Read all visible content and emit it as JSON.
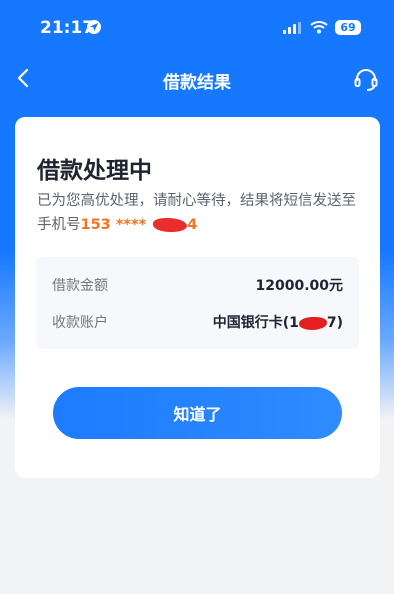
{
  "status_bar": {
    "time": "21:17",
    "battery": "69"
  },
  "nav": {
    "title": "借款结果",
    "back_icon": "chevron-left-icon",
    "support_icon": "headset-icon"
  },
  "result": {
    "title": "借款处理中",
    "description": "已为您高优处理，请耐心等待，结果将短信发送至手机号",
    "phone_visible": "153 **** ",
    "phone_tail_hint": "4"
  },
  "details": [
    {
      "label": "借款金额",
      "value": "12000.00元"
    },
    {
      "label": "收款账户",
      "value_prefix": "中国银行卡(1",
      "value_suffix": "7)"
    }
  ],
  "actions": {
    "confirm_label": "知道了"
  },
  "colors": {
    "primary": "#1677ff",
    "phone_highlight": "#f27321",
    "redaction": "#e51f1f"
  }
}
